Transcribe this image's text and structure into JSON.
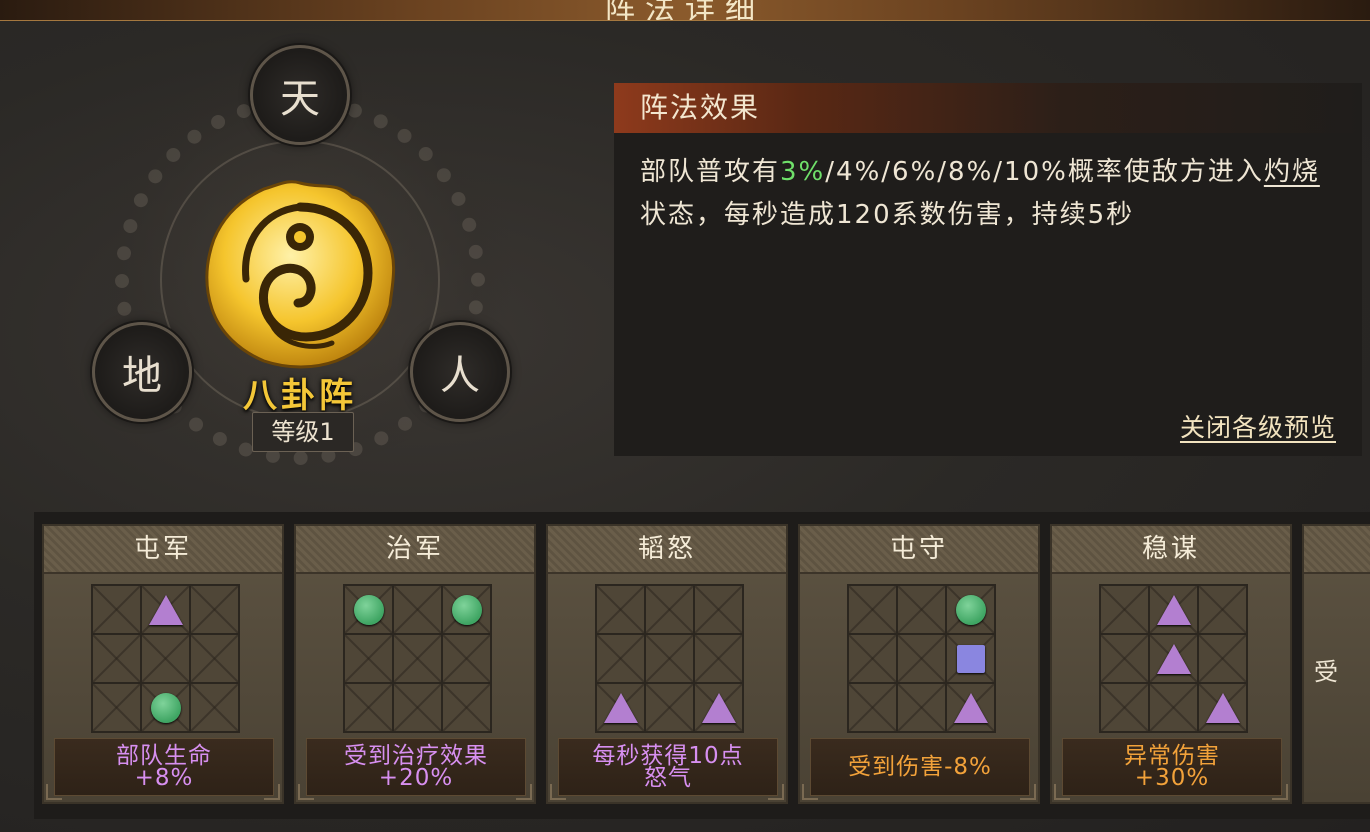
{
  "header": {
    "title": "阵法详细"
  },
  "formation": {
    "name": "八卦阵",
    "level": "等级1",
    "nodes": {
      "top": "天",
      "left": "地",
      "right": "人"
    },
    "emblem_icon": "yin-yang-flame-emblem"
  },
  "effect": {
    "title": "阵法效果",
    "text_prefix": "部队普攻有",
    "highlight": "3%",
    "text_mid": "/4%/6%/8%/10%概率使敌方进入",
    "status_word": "灼烧",
    "text_suffix": "状态，每秒造成120系数伤害，持续5秒",
    "close_preview": "关闭各级预览"
  },
  "colors": {
    "accent_gold": "#f4c738",
    "highlight_green": "#6fe06a",
    "purple_text": "#d78ff0",
    "orange_text": "#f2a23a",
    "triangle": "#b37fd0",
    "circle": "#3fa563",
    "square": "#8a86e0"
  },
  "cards": [
    {
      "title": "屯军",
      "grid": [
        "",
        "triangle",
        "",
        "",
        "",
        "",
        "",
        "circle",
        ""
      ],
      "desc_line1": "部队生命",
      "desc_line2": "+8%",
      "desc_color": "purple"
    },
    {
      "title": "治军",
      "grid": [
        "circle",
        "",
        "circle",
        "",
        "",
        "",
        "",
        "",
        ""
      ],
      "desc_line1": "受到治疗效果",
      "desc_line2": "+20%",
      "desc_color": "purple"
    },
    {
      "title": "韬怒",
      "grid": [
        "",
        "",
        "",
        "",
        "",
        "",
        "triangle",
        "",
        "triangle"
      ],
      "desc_line1": "每秒获得10点",
      "desc_line2": "怒气",
      "desc_color": "purple"
    },
    {
      "title": "屯守",
      "grid": [
        "",
        "",
        "circle",
        "",
        "",
        "square",
        "",
        "",
        "triangle"
      ],
      "desc_line1": "受到伤害-8%",
      "desc_line2": "",
      "desc_color": "orange"
    },
    {
      "title": "稳谋",
      "grid": [
        "",
        "triangle",
        "",
        "",
        "triangle",
        "",
        "",
        "",
        "triangle"
      ],
      "desc_line1": "异常伤害",
      "desc_line2": "+30%",
      "desc_color": "orange"
    }
  ],
  "partial_card": {
    "text": "受"
  }
}
